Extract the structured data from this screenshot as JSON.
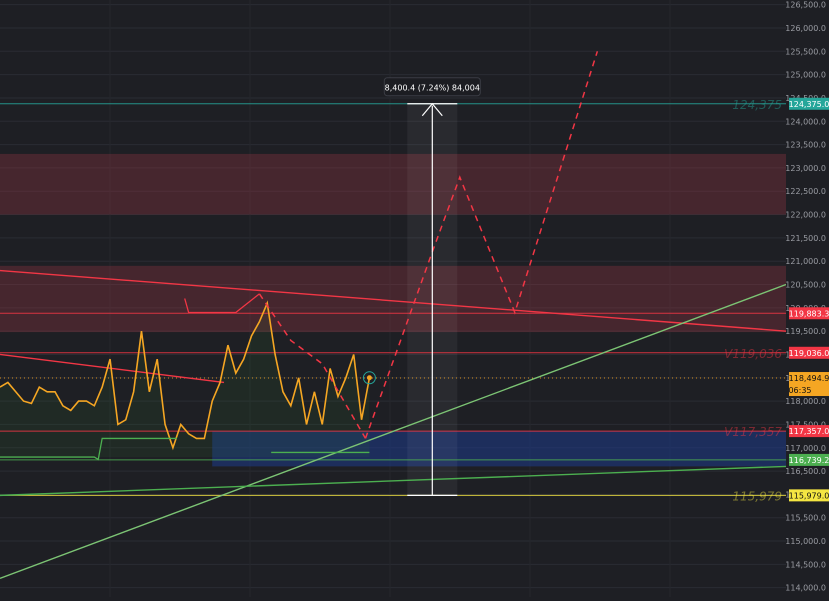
{
  "chart_data": {
    "type": "line",
    "title": "",
    "xlabel": "",
    "ylabel": "",
    "ylim": [
      113800,
      126600
    ],
    "y_ticks": [
      "114,000.0",
      "114,500.0",
      "115,000.0",
      "115,500.0",
      "116,000.0",
      "116,500.0",
      "117,000.0",
      "117,500.0",
      "118,000.0",
      "118,500.0",
      "119,000.0",
      "119,500.0",
      "120,000.0",
      "120,500.0",
      "121,000.0",
      "121,500.0",
      "122,000.0",
      "122,500.0",
      "123,000.0",
      "123,500.0",
      "124,000.0",
      "124,500.0",
      "125,000.0",
      "125,500.0",
      "126,000.0",
      "126,500.0"
    ],
    "y_tick_values": [
      114000,
      114500,
      115000,
      115500,
      116000,
      116500,
      117000,
      117500,
      118000,
      118500,
      119000,
      119500,
      120000,
      120500,
      121000,
      121500,
      122000,
      122500,
      123000,
      123500,
      124000,
      124500,
      125000,
      125500,
      126000,
      126500
    ],
    "xlim": [
      0,
      100
    ],
    "grid": true,
    "colors": {
      "background": "#1e1f24",
      "price": "#f5a623",
      "resistance": "#f23645",
      "support": "#4caf50",
      "projection": "#f23645",
      "measure": "#ffffff",
      "target_line": "#26a69a",
      "blue_zone": "#1e3a8a",
      "yellow_line": "#f5e642"
    },
    "series": [
      {
        "kind": "price",
        "x": [
          0,
          1,
          2,
          3,
          4,
          5,
          6,
          7,
          8,
          9,
          10,
          11,
          12,
          13,
          14,
          15,
          16,
          17,
          18,
          19,
          20,
          21,
          22,
          23,
          24,
          25,
          26,
          27,
          28,
          29,
          30,
          31,
          32,
          33,
          34,
          35,
          36,
          37,
          38,
          39,
          40,
          41,
          42,
          43,
          44,
          45,
          46,
          47
        ],
        "values": [
          118300,
          118400,
          118200,
          118000,
          117950,
          118300,
          118200,
          118200,
          117900,
          117800,
          118000,
          118000,
          117900,
          118300,
          118900,
          117500,
          117600,
          118200,
          119500,
          118200,
          118900,
          117500,
          117000,
          117500,
          117300,
          117200,
          117200,
          118000,
          118400,
          119200,
          118600,
          118900,
          119400,
          119700,
          120100,
          119000,
          118200,
          117900,
          118500,
          117500,
          118200,
          117500,
          118700,
          118100,
          118500,
          119000,
          117600,
          118500
        ]
      },
      {
        "kind": "projection",
        "x": [
          46.5,
          55,
          58.5,
          65.5,
          76
        ],
        "values": [
          117200,
          121200,
          122800,
          119900,
          125500
        ]
      },
      {
        "kind": "pre-projection",
        "x": [
          33,
          37,
          41,
          46.5
        ],
        "values": [
          120300,
          119300,
          118800,
          117200
        ]
      },
      {
        "kind": "lower-band",
        "x": [
          0,
          12,
          12.5,
          13,
          22.5
        ],
        "values": [
          116800,
          116800,
          116750,
          117200,
          117200
        ]
      },
      {
        "kind": "upper-band",
        "x": [
          23.5,
          24,
          30,
          33
        ],
        "values": [
          120200,
          119900,
          119900,
          120300
        ]
      },
      {
        "kind": "mini-band",
        "x": [
          34.5,
          47
        ],
        "values": [
          116900,
          116900
        ]
      }
    ],
    "trendlines": [
      {
        "name": "",
        "from": [
          0,
          120800
        ],
        "to": [
          100,
          119500
        ],
        "color": "#f23645"
      },
      {
        "name": "",
        "from": [
          0,
          119000
        ],
        "to": [
          28.5,
          118400
        ],
        "color": "#f23645"
      },
      {
        "name": "",
        "from": [
          0,
          114200
        ],
        "to": [
          100,
          120500
        ],
        "color": "#7cc474"
      },
      {
        "name": "",
        "from": [
          0,
          115979
        ],
        "to": [
          100,
          116600
        ],
        "color": "#4caf50"
      }
    ],
    "zones": [
      {
        "name": "",
        "y0": 122000,
        "y1": 123300,
        "color": "#b03a48"
      },
      {
        "name": "",
        "y0": 119480,
        "y1": 120900,
        "color": "#b03a48"
      },
      {
        "name": "",
        "x0": 27,
        "x1": 100,
        "y0": 116600,
        "y1": 117357,
        "color": "#1e3a8a"
      }
    ],
    "levels": [
      {
        "value": 124375,
        "label": "124,375",
        "tag": "124,375.0",
        "color": "#26a69a"
      },
      {
        "value": 119883.3,
        "label": "",
        "tag": "119,883.3",
        "color": "#f23645"
      },
      {
        "value": 119036,
        "label": "V119,036",
        "tag": "119,036.0",
        "color": "#f23645"
      },
      {
        "value": 118494.9,
        "label": "",
        "tag": "118,494.9",
        "tag2": "06:35",
        "color": "#f5a623"
      },
      {
        "value": 117357,
        "label": "V117,357",
        "tag": "117,357.0",
        "color": "#f23645"
      },
      {
        "value": 116739.2,
        "label": "",
        "tag": "116,739.2",
        "color": "#4caf50"
      },
      {
        "value": 115979,
        "label": "115,979",
        "tag": "115,979.0",
        "color": "#f5e642"
      }
    ],
    "measure": {
      "x": 55,
      "from": 115979,
      "to": 124375,
      "label": "8,400.4 (7.24%) 84,004"
    }
  }
}
